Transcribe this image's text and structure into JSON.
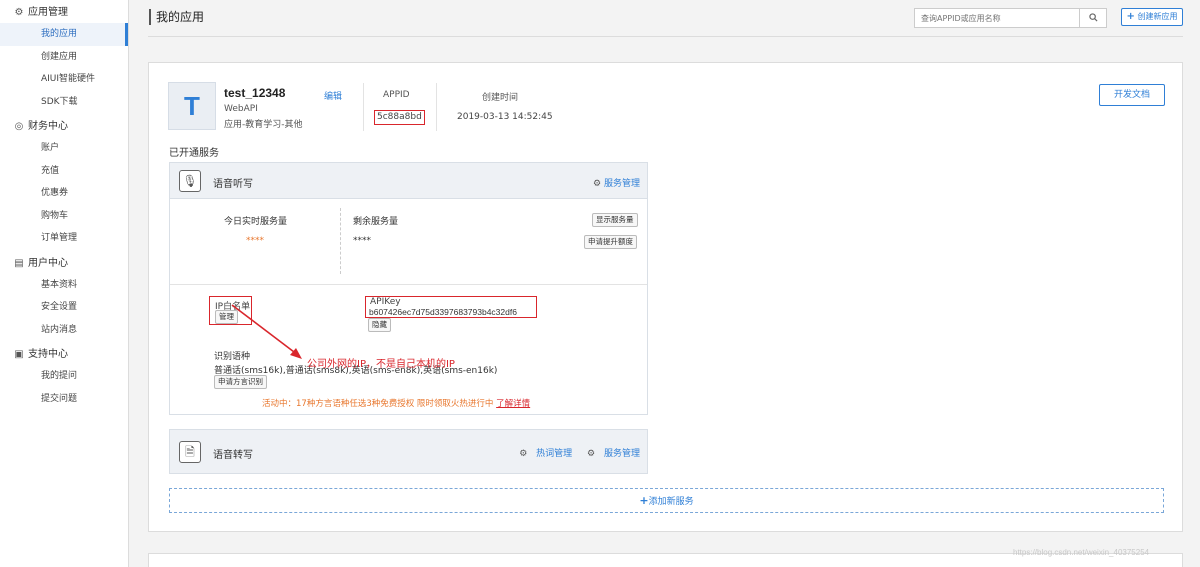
{
  "sidebar": {
    "groups": [
      {
        "icon": "gear-icon",
        "title": "应用管理",
        "items": [
          {
            "label": "我的应用",
            "active": true
          },
          {
            "label": "创建应用"
          },
          {
            "label": "AIUI智能硬件"
          },
          {
            "label": "SDK下载"
          }
        ]
      },
      {
        "icon": "finance-icon",
        "title": "财务中心",
        "items": [
          {
            "label": "账户"
          },
          {
            "label": "充值"
          },
          {
            "label": "优惠券"
          },
          {
            "label": "购物车"
          },
          {
            "label": "订单管理"
          }
        ]
      },
      {
        "icon": "user-card-icon",
        "title": "用户中心",
        "items": [
          {
            "label": "基本资料"
          },
          {
            "label": "安全设置"
          },
          {
            "label": "站内消息"
          }
        ]
      },
      {
        "icon": "support-icon",
        "title": "支持中心",
        "items": [
          {
            "label": "我的提问"
          },
          {
            "label": "提交问题"
          }
        ]
      }
    ]
  },
  "header": {
    "title": "我的应用",
    "search_placeholder": "查询APPID或应用名称",
    "create_label": "创建新应用"
  },
  "app": {
    "avatar_letter": "T",
    "name": "test_12348",
    "type": "WebAPI",
    "category": "应用-教育学习-其他",
    "edit_label": "编辑",
    "appid_label": "APPID",
    "appid": "5c88a8bd",
    "created_label": "创建时间",
    "created_at": "2019-03-13 14:52:45",
    "doc_label": "开发文档",
    "opened_label": "已开通服务"
  },
  "services": {
    "dictation": {
      "title": "语音听写",
      "manage_label": "服务管理",
      "today_label": "今日实时服务量",
      "today_value": "****",
      "remaining_label": "剩余服务量",
      "remaining_value": "****",
      "show_quota_label": "显示服务量",
      "raise_quota_label": "申请提升额度",
      "ip_whitelist_label": "IP白名单",
      "ip_manage_label": "管理",
      "apikey_label": "APIKey",
      "apikey": "b607426ec7d75d3397683793b4c32df6",
      "hide_label": "隐藏",
      "lang_label": "识别语种",
      "lang_value": "普通话(sms16k),普通话(sms8k),英语(sms-en8k),英语(sms-en16k)",
      "dialect_label": "申请方言识别",
      "annotation": "公司外网的IP，不是自己本机的IP",
      "promo_text": "活动中：17种方言语种任选3种免费授权  限时领取火热进行中",
      "promo_link": "了解详情"
    },
    "transcription": {
      "title": "语音转写",
      "hotword_label": "热词管理",
      "manage_label": "服务管理"
    }
  },
  "add_service_label": "添加新服务",
  "watermark": "https://blog.csdn.net/weixin_40375254",
  "colors": {
    "accent": "#2f7fd6",
    "highlight": "#d9262c",
    "promo": "#e8772e"
  }
}
